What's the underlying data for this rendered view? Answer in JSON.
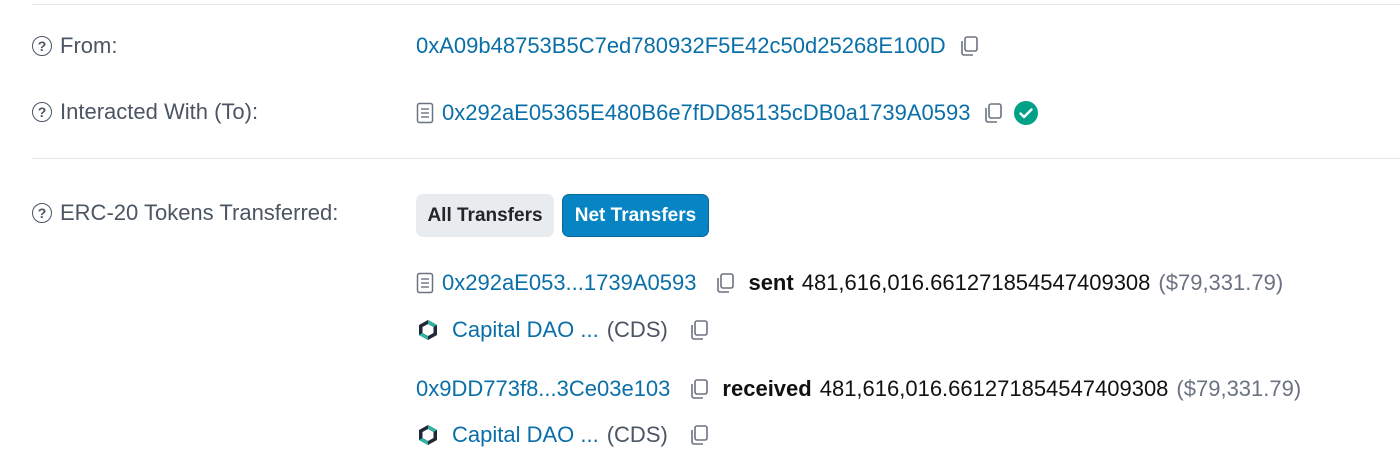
{
  "from": {
    "label": "From:",
    "address": "0xA09b48753B5C7ed780932F5E42c50d25268E100D"
  },
  "to": {
    "label": "Interacted With (To):",
    "address": "0x292aE05365E480B6e7fDD85135cDB0a1739A0593"
  },
  "erc20": {
    "label": "ERC-20 Tokens Transferred:",
    "tabs": {
      "all": "All Transfers",
      "net": "Net Transfers"
    },
    "transfers": [
      {
        "address": "0x292aE053...1739A0593",
        "action": "sent",
        "amount": "481,616,016.661271854547409308",
        "usd": "($79,331.79)",
        "token_name": "Capital DAO ...",
        "token_symbol": "(CDS)"
      },
      {
        "address": "0x9DD773f8...3Ce03e103",
        "action": "received",
        "amount": "481,616,016.661271854547409308",
        "usd": "($79,331.79)",
        "token_name": "Capital DAO ...",
        "token_symbol": "(CDS)"
      }
    ]
  },
  "colors": {
    "link": "#0a6fa8",
    "primary_button": "#0784c3",
    "verified": "#00a186"
  }
}
